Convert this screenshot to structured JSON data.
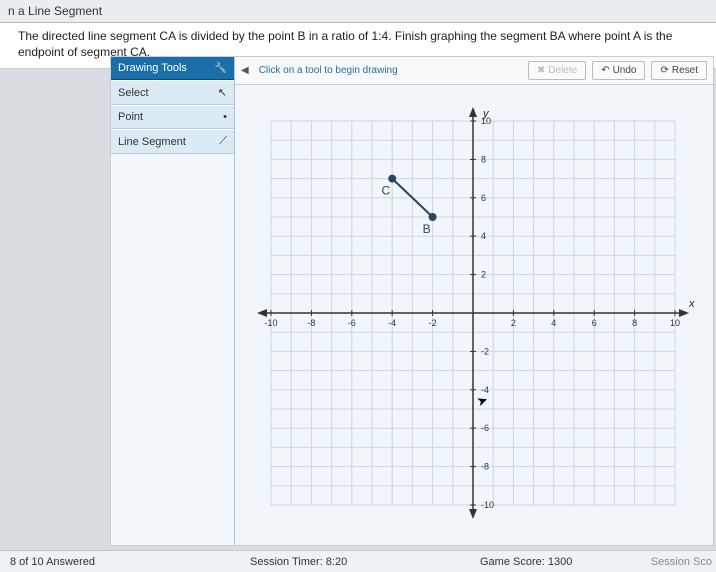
{
  "header": {
    "title": "n a Line Segment"
  },
  "instruction": "The directed line segment CA is divided by the point B in a ratio of 1:4. Finish graphing the segment BA where point A is the endpoint of segment CA.",
  "toolbox": {
    "header": "Drawing Tools",
    "items": [
      {
        "label": "Select",
        "icon": "↖"
      },
      {
        "label": "Point",
        "icon": "•"
      },
      {
        "label": "Line Segment",
        "icon": "⟋"
      }
    ]
  },
  "graph_toolbar": {
    "hint": "Click on a tool to begin drawing",
    "delete": "Delete",
    "undo": "Undo",
    "reset": "Reset"
  },
  "chart_data": {
    "type": "scatter",
    "title": "",
    "xlabel": "x",
    "ylabel": "y",
    "xlim": [
      -10,
      10
    ],
    "ylim": [
      -10,
      10
    ],
    "xticks": [
      -10,
      -8,
      -6,
      -4,
      -2,
      2,
      4,
      6,
      8,
      10
    ],
    "yticks": [
      -10,
      -8,
      -6,
      -4,
      -2,
      2,
      4,
      6,
      8,
      10
    ],
    "series": [
      {
        "name": "C",
        "x": -4,
        "y": 7
      },
      {
        "name": "B",
        "x": -2,
        "y": 5
      }
    ],
    "segments": [
      {
        "from": "C",
        "to": "B"
      }
    ]
  },
  "footer": {
    "answered": "8 of 10 Answered",
    "timer": "Session Timer: 8:20",
    "score": "Game Score: 1300",
    "session": "Session Sco"
  }
}
